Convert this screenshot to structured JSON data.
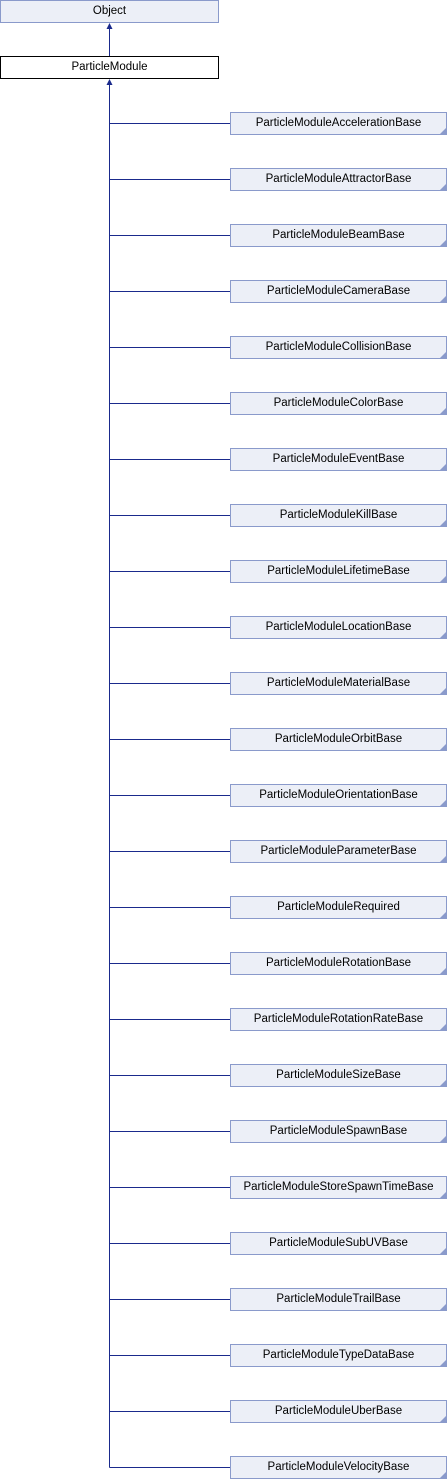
{
  "diagram": {
    "root": {
      "label": "Object"
    },
    "current": {
      "label": "ParticleModule"
    },
    "children": [
      "ParticleModuleAccelerationBase",
      "ParticleModuleAttractorBase",
      "ParticleModuleBeamBase",
      "ParticleModuleCameraBase",
      "ParticleModuleCollisionBase",
      "ParticleModuleColorBase",
      "ParticleModuleEventBase",
      "ParticleModuleKillBase",
      "ParticleModuleLifetimeBase",
      "ParticleModuleLocationBase",
      "ParticleModuleMaterialBase",
      "ParticleModuleOrbitBase",
      "ParticleModuleOrientationBase",
      "ParticleModuleParameterBase",
      "ParticleModuleRequired",
      "ParticleModuleRotationBase",
      "ParticleModuleRotationRateBase",
      "ParticleModuleSizeBase",
      "ParticleModuleSpawnBase",
      "ParticleModuleStoreSpawnTimeBase",
      "ParticleModuleSubUVBase",
      "ParticleModuleTrailBase",
      "ParticleModuleTypeDataBase",
      "ParticleModuleUberBase",
      "ParticleModuleVelocityBase"
    ],
    "colors": {
      "edge": "#1a2a8c",
      "node_fill": "#eceff7",
      "node_border": "#8a9acb"
    }
  }
}
